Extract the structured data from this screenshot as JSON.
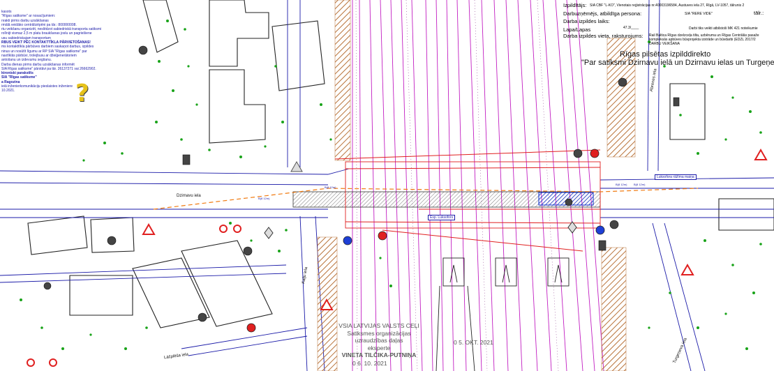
{
  "map": {
    "notes": [
      "kasots",
      "\"Rīgas satiksme\" ar nosacījumiem:",
      "nrakti pirms darbu uzsākšanas",
      "rmālā veidāko centrālizēpēni pa tār.: 800000008.",
      "rtu veikšanu organizēt, neslēdzot sabiedriskā transporta satiksmi",
      "rolīnijt vismaz 2,5 m platu braukšanas joslu un pagriešiene",
      "usu sabiedriskajam transportam",
      "RBUS VEIKT PĒC KONTAKTTĪKLA PĀRVIETOŠANAS!",
      "ms kontakttīkla pārbūves darbiem saskaņot darbus, izpildes",
      "ninus un nosūtīt līgumu ar RP SIA \"Rīgas satiksme\" par",
      "naxtīklās pārbūvi, trolejbusu ar džeiģenerātoriem",
      "antošanu un izdevumu segšanu.",
      "Darba dienas pirms darbu uzsākšanas informēt",
      "SIA Rīgas satiksme\" pārstāvi pa tār. 26137271 vai 26662902.",
      "ktroniski parakstīts",
      "SIA \"Rīgas satiksme\"",
      "a Ragozina",
      "ieiā inženierkomunikāciju pieslaistes inženiere",
      "10.2021."
    ],
    "info": {
      "izpilditajs_label": "Izpildītājs:",
      "izpilditajs_value": "SIA CBF \"L-KO\", Vienotais reģistrācijas nr.40003196584, Austuves iela 27, Rīgā, LV-1057, tālrunis 2",
      "darbuznemejs_label": "Darbuzņēmējs, atbildīga persona:",
      "darbuznemejs_value": "SIA \"RERE VIDE\"",
      "tal_label": "tālr.:",
      "laiks_label": "Darba izpildes laiks:",
      "lapa_label": "Lapa/Lapas",
      "lapa_value": "47.3/____",
      "mk_note": "Darbi tiks veikti atbilstoši MK 421 noteikumie",
      "vieta_label": "Darba izpildes vieta, raksturojums:",
      "vieta_line1": "Rail Baltica Rīgas dzelzceļa tilta, uzbēruma un Rīgas Centrālās pasaže",
      "vieta_line2": "kompleksās apbūves būvprojekta izstrāde un būvdarbi (EDZL 2017/2",
      "vieta_line3": "DARBU VEIKŠANA"
    },
    "title_line1": "Rīgas pilsētas izpilddirekto",
    "title_line2": "\"Par satiksmi Dzirnavu ielā un Dzirnavu ielas un Turgeņeva iela",
    "stamp": {
      "line1": "VSIA LATVIJAS VALSTS CEĻI",
      "line2": "Satiksmes organizācijas",
      "line3": "uzraudzības daļas",
      "line4": "eksperte",
      "line5": "VINETA TILČIKA-PUTNIŅA",
      "date1": "0 5. OKT. 2021",
      "date2": "0 6. 10. 2021"
    },
    "street_labels": {
      "dzirnavu": "Dzirnavu iela",
      "kaiju": "Kaiju iela",
      "abrenes": "Abrenes iela",
      "turgeneva": "Turgeņeva iela",
      "lacplesa": "Lāčplēša iela"
    },
    "box_labels": {
      "luksofora": "Luksofora rāžīma maiņa",
      "esp": "Esp. Luksofors"
    },
    "dim_labels": [
      "B(8 12m)",
      "B(8 12m)",
      "B(8 12m)",
      "B(8 12m)"
    ],
    "colors": {
      "rail": "#c21fc2",
      "road_edge": "#1a1aa8",
      "barrier": "#e02020",
      "hatch": "#b8733a",
      "tree": "#19a319",
      "building": "#222222",
      "water_fill": "#1e3fd6"
    },
    "icons": [
      "question-mark-icon",
      "traffic-sign-icon",
      "tree-icon",
      "traffic-light-icon"
    ]
  }
}
